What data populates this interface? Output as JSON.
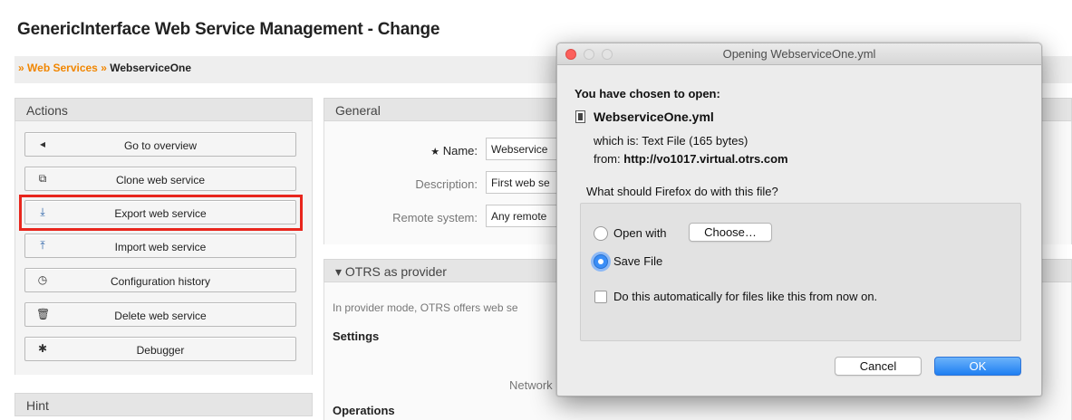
{
  "page": {
    "title": "GenericInterface Web Service Management - Change"
  },
  "breadcrumb": {
    "sep1": "»",
    "link": "Web Services",
    "sep2": "»",
    "current": "WebserviceOne"
  },
  "actions": {
    "header": "Actions",
    "buttons": [
      {
        "label": "Go to overview",
        "icon": "arrow-left-icon"
      },
      {
        "label": "Clone web service",
        "icon": "clone-icon"
      },
      {
        "label": "Export web service",
        "icon": "download-icon"
      },
      {
        "label": "Import web service",
        "icon": "upload-icon"
      },
      {
        "label": "Configuration history",
        "icon": "clock-icon"
      },
      {
        "label": "Delete web service",
        "icon": "trash-icon"
      },
      {
        "label": "Debugger",
        "icon": "bug-icon"
      }
    ]
  },
  "hint": {
    "header": "Hint"
  },
  "general": {
    "header": "General",
    "name_marker": "★",
    "name_label": "Name:",
    "name_value": "Webservice",
    "description_label": "Description:",
    "description_value": "First web se",
    "remote_label": "Remote system:",
    "remote_value": "Any remote"
  },
  "provider": {
    "header": "▾ OTRS as provider",
    "text": "In provider mode, OTRS offers web se",
    "settings": "Settings",
    "network": "Network",
    "operations": "Operations"
  },
  "dialog": {
    "title": "Opening WebserviceOne.yml",
    "chosen": "You have chosen to open:",
    "filename": "WebserviceOne.yml",
    "which_is": "which is:  Text File (165 bytes)",
    "from_label": "from:",
    "from_url": "http://vo1017.virtual.otrs.com",
    "question": "What should Firefox do with this file?",
    "open_with": "Open with",
    "choose": "Choose…",
    "save_file": "Save File",
    "auto_text": "Do this automatically for files like this from now on.",
    "cancel": "Cancel",
    "ok": "OK"
  }
}
